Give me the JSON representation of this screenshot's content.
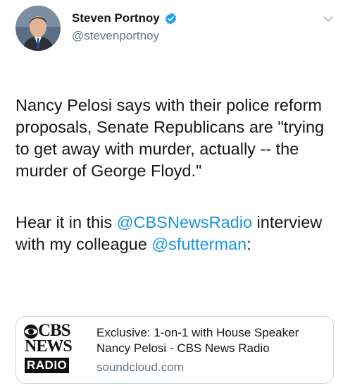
{
  "author": {
    "display_name": "Steven Portnoy",
    "handle": "@stevenportnoy",
    "verified": true
  },
  "icons": {
    "verified": "verified-badge-icon",
    "menu": "chevron-down-icon",
    "avatar": "profile-photo"
  },
  "tweet": {
    "paragraph1": "Nancy Pelosi says with their police reform proposals, Senate Republicans are \"trying to get away with murder, actually -- the murder of George Floyd.\"",
    "paragraph2_before": "Hear it in this ",
    "mention1": "@CBSNewsRadio",
    "paragraph2_middle": " interview with my colleague ",
    "mention2": "@sfutterman",
    "paragraph2_after": ":"
  },
  "card": {
    "title": "Exclusive: 1-on-1 with House Speaker Nancy Pelosi - CBS News Radio",
    "domain": "soundcloud.com",
    "logo": {
      "line1": "CBS",
      "line2": "NEWS",
      "line3": "RADIO"
    }
  },
  "colors": {
    "link": "#1b95e0",
    "verified": "#1da1f2",
    "secondary_text": "#657786",
    "border": "#ccd6dd"
  }
}
